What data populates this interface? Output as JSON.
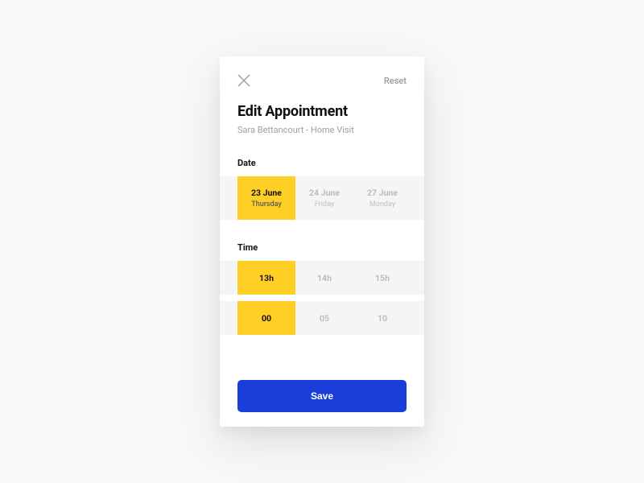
{
  "header": {
    "reset_label": "Reset",
    "title": "Edit Appointment",
    "subtitle": "Sara Bettancourt - Home Visit"
  },
  "date": {
    "label": "Date",
    "options": [
      {
        "date": "23 June",
        "day": "Thursday",
        "selected": true
      },
      {
        "date": "24 June",
        "day": "Friday",
        "selected": false
      },
      {
        "date": "27 June",
        "day": "Monday",
        "selected": false
      }
    ]
  },
  "time": {
    "label": "Time",
    "hours": [
      {
        "value": "13h",
        "selected": true
      },
      {
        "value": "14h",
        "selected": false
      },
      {
        "value": "15h",
        "selected": false
      }
    ],
    "minutes": [
      {
        "value": "00",
        "selected": true
      },
      {
        "value": "05",
        "selected": false
      },
      {
        "value": "10",
        "selected": false
      }
    ]
  },
  "actions": {
    "save_label": "Save"
  },
  "colors": {
    "accent_yellow": "#ffcf26",
    "primary_blue": "#1a3fd8",
    "strip_bg": "#f5f5f5"
  }
}
